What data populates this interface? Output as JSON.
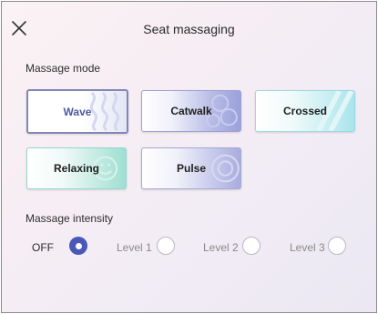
{
  "header": {
    "title": "Seat massaging",
    "close_icon": "close-icon"
  },
  "massage_mode": {
    "label": "Massage mode",
    "selected": "Wave",
    "modes": [
      {
        "label": "Wave",
        "icon": "wave-pattern-icon",
        "accent": "#8286b6",
        "selected": true
      },
      {
        "label": "Catwalk",
        "icon": "catwalk-pattern-icon",
        "accent": "#9aa1dc",
        "selected": false
      },
      {
        "label": "Crossed",
        "icon": "crossed-pattern-icon",
        "accent": "#a9e4ec",
        "selected": false
      },
      {
        "label": "Relaxing",
        "icon": "relaxing-pattern-icon",
        "accent": "#9edfd2",
        "selected": false
      },
      {
        "label": "Pulse",
        "icon": "pulse-pattern-icon",
        "accent": "#a9addf",
        "selected": false
      }
    ]
  },
  "massage_intensity": {
    "label": "Massage intensity",
    "selected": "OFF",
    "options": [
      {
        "label": "OFF",
        "selected": true
      },
      {
        "label": "Level 1",
        "selected": false
      },
      {
        "label": "Level 2",
        "selected": false
      },
      {
        "label": "Level 3",
        "selected": false
      }
    ]
  },
  "colors": {
    "accent": "#4a59b8",
    "selected_border": "#8286b6"
  }
}
